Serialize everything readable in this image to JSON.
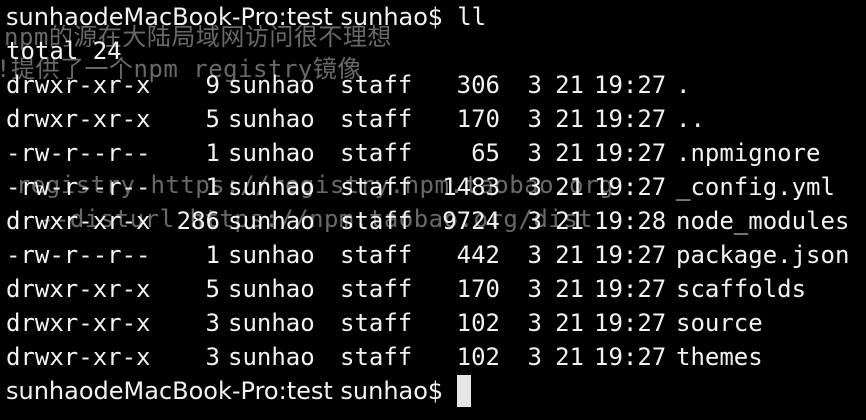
{
  "terminal": {
    "background": "#000000",
    "foreground": "#f2f2f2",
    "prompt": "sunhaodeMacBook-Pro:test sunhao$",
    "command": "ll",
    "total_line": "total 24",
    "rows": [
      {
        "perms": "drwxr-xr-x",
        "links": "9",
        "owner": "sunhao",
        "group": "staff",
        "size": "306",
        "month": "3",
        "day": "21",
        "time": "19:27",
        "name": "."
      },
      {
        "perms": "drwxr-xr-x",
        "links": "5",
        "owner": "sunhao",
        "group": "staff",
        "size": "170",
        "month": "3",
        "day": "21",
        "time": "19:27",
        "name": ".."
      },
      {
        "perms": "-rw-r--r--",
        "links": "1",
        "owner": "sunhao",
        "group": "staff",
        "size": "65",
        "month": "3",
        "day": "21",
        "time": "19:27",
        "name": ".npmignore"
      },
      {
        "perms": "-rw-r--r--",
        "links": "1",
        "owner": "sunhao",
        "group": "staff",
        "size": "1483",
        "month": "3",
        "day": "21",
        "time": "19:27",
        "name": "_config.yml"
      },
      {
        "perms": "drwxr-xr-x",
        "links": "286",
        "owner": "sunhao",
        "group": "staff",
        "size": "9724",
        "month": "3",
        "day": "21",
        "time": "19:28",
        "name": "node_modules"
      },
      {
        "perms": "-rw-r--r--",
        "links": "1",
        "owner": "sunhao",
        "group": "staff",
        "size": "442",
        "month": "3",
        "day": "21",
        "time": "19:27",
        "name": "package.json"
      },
      {
        "perms": "drwxr-xr-x",
        "links": "5",
        "owner": "sunhao",
        "group": "staff",
        "size": "170",
        "month": "3",
        "day": "21",
        "time": "19:27",
        "name": "scaffolds"
      },
      {
        "perms": "drwxr-xr-x",
        "links": "3",
        "owner": "sunhao",
        "group": "staff",
        "size": "102",
        "month": "3",
        "day": "21",
        "time": "19:27",
        "name": "source"
      },
      {
        "perms": "drwxr-xr-x",
        "links": "3",
        "owner": "sunhao",
        "group": "staff",
        "size": "102",
        "month": "3",
        "day": "21",
        "time": "19:27",
        "name": "themes"
      }
    ],
    "final_prompt": "sunhaodeMacBook-Pro:test sunhao$"
  },
  "ghost_text": {
    "line1": "npm的源在大陆局域网访问很不理想",
    "line2": "!提供了一个npm registry镜像",
    "line3": "r registry https://registry.npm.taobao.org",
    "line4": "--disturl https://npm.taobao.org/dist"
  }
}
